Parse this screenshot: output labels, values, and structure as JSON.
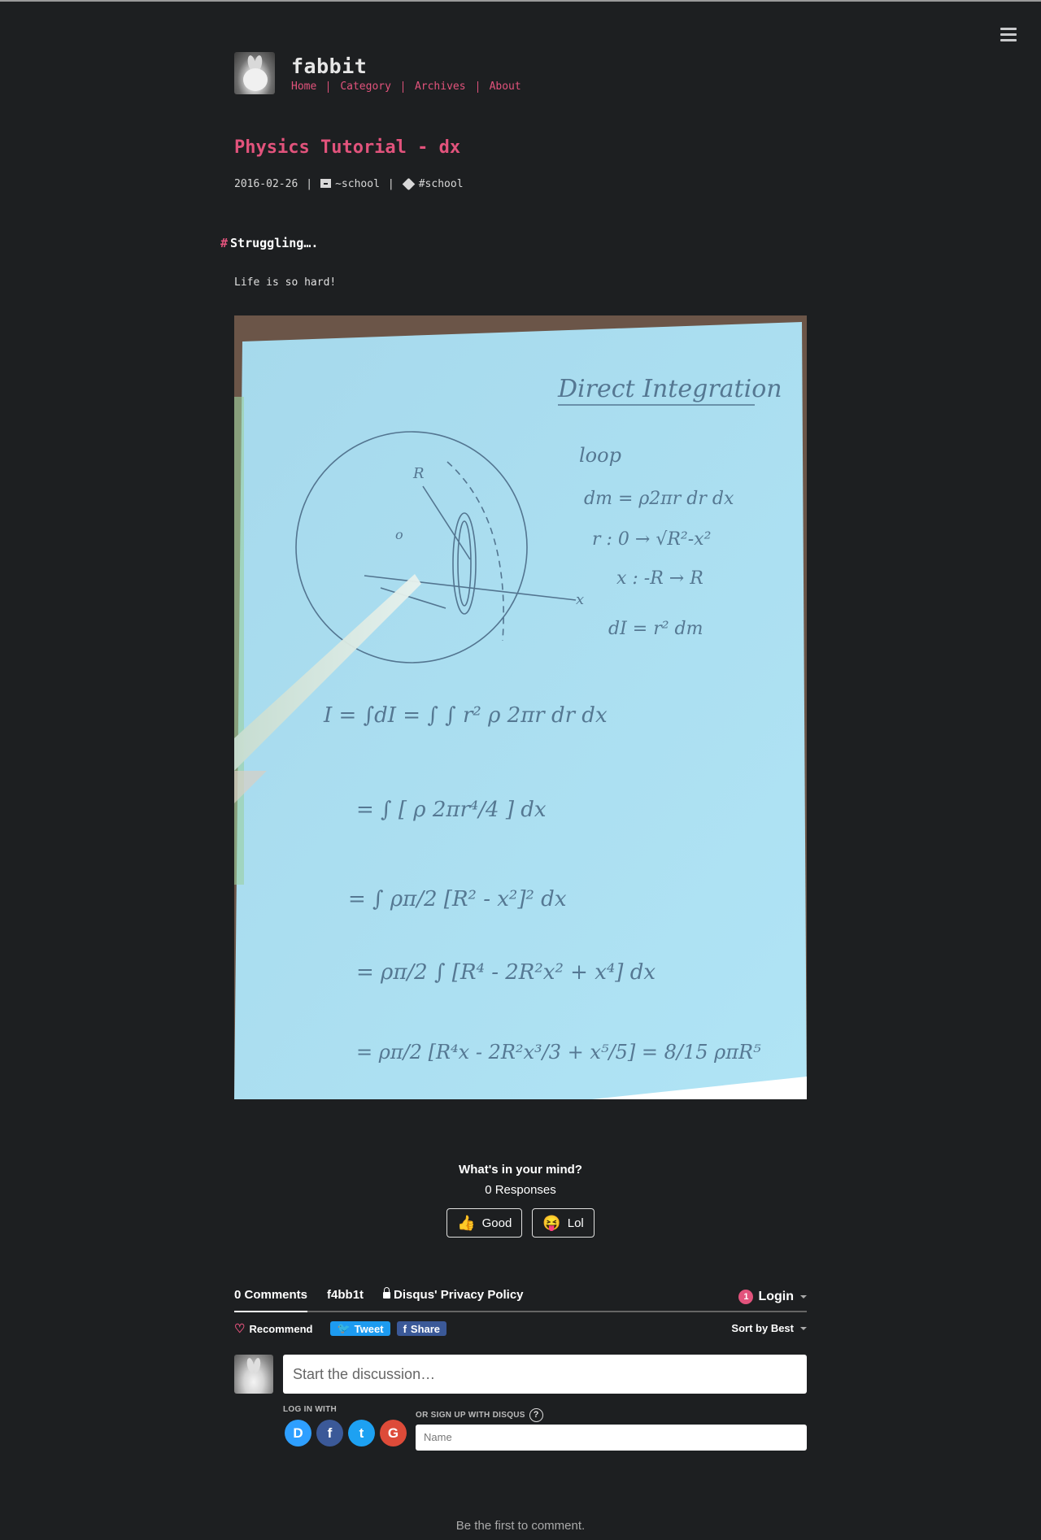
{
  "site": {
    "title": "fabbit",
    "nav": [
      "Home",
      "Category",
      "Archives",
      "About"
    ]
  },
  "post": {
    "title": "Physics Tutorial - dx",
    "date": "2016-02-26",
    "category": "~school",
    "tag": "#school",
    "heading_hash": "#",
    "heading": "Struggling….",
    "paragraph": "Life is so hard!",
    "photo": {
      "handwriting_title": "Direct Integration",
      "lines": [
        "loop",
        "dm = ρ2πr dr dx",
        "r :  0 → √(R²-x²)",
        "x : -R → R",
        "dI = r² dm",
        "I = ∫dI = ∫ ∫ r² ρ 2πr dr dx",
        "= ∫ [ ρ 2πr⁴/4 ] dx",
        "= ∫ ρπ/2 [R² - x²]² dx",
        "= ρπ/2 ∫ [R⁴ - 2R²x² + x⁴] dx",
        "= ρπ/2 [R⁴x - 2R²x³/3 + x⁵/5] = 8/15 ρπR⁵"
      ]
    }
  },
  "reactions": {
    "title": "What's in your mind?",
    "count": "0 Responses",
    "buttons": [
      {
        "emoji": "👍",
        "label": "Good"
      },
      {
        "emoji": "😝",
        "label": "Lol"
      }
    ]
  },
  "disqus": {
    "tabs": [
      "0 Comments",
      "f4bb1t",
      "Disqus' Privacy Policy"
    ],
    "login_badge": "1",
    "login": "Login",
    "recommend": "Recommend",
    "tweet": "Tweet",
    "share": "Share",
    "sort": "Sort by Best",
    "placeholder": "Start the discussion…",
    "login_with": "LOG IN WITH",
    "socials": [
      "D",
      "f",
      "t",
      "G"
    ],
    "signup": "OR SIGN UP WITH DISQUS",
    "help": "?",
    "name_placeholder": "Name",
    "empty": "Be the first to comment."
  },
  "colors": {
    "background": "#1d1f21",
    "accent": "#e2537c",
    "paper": "#a8def0"
  }
}
